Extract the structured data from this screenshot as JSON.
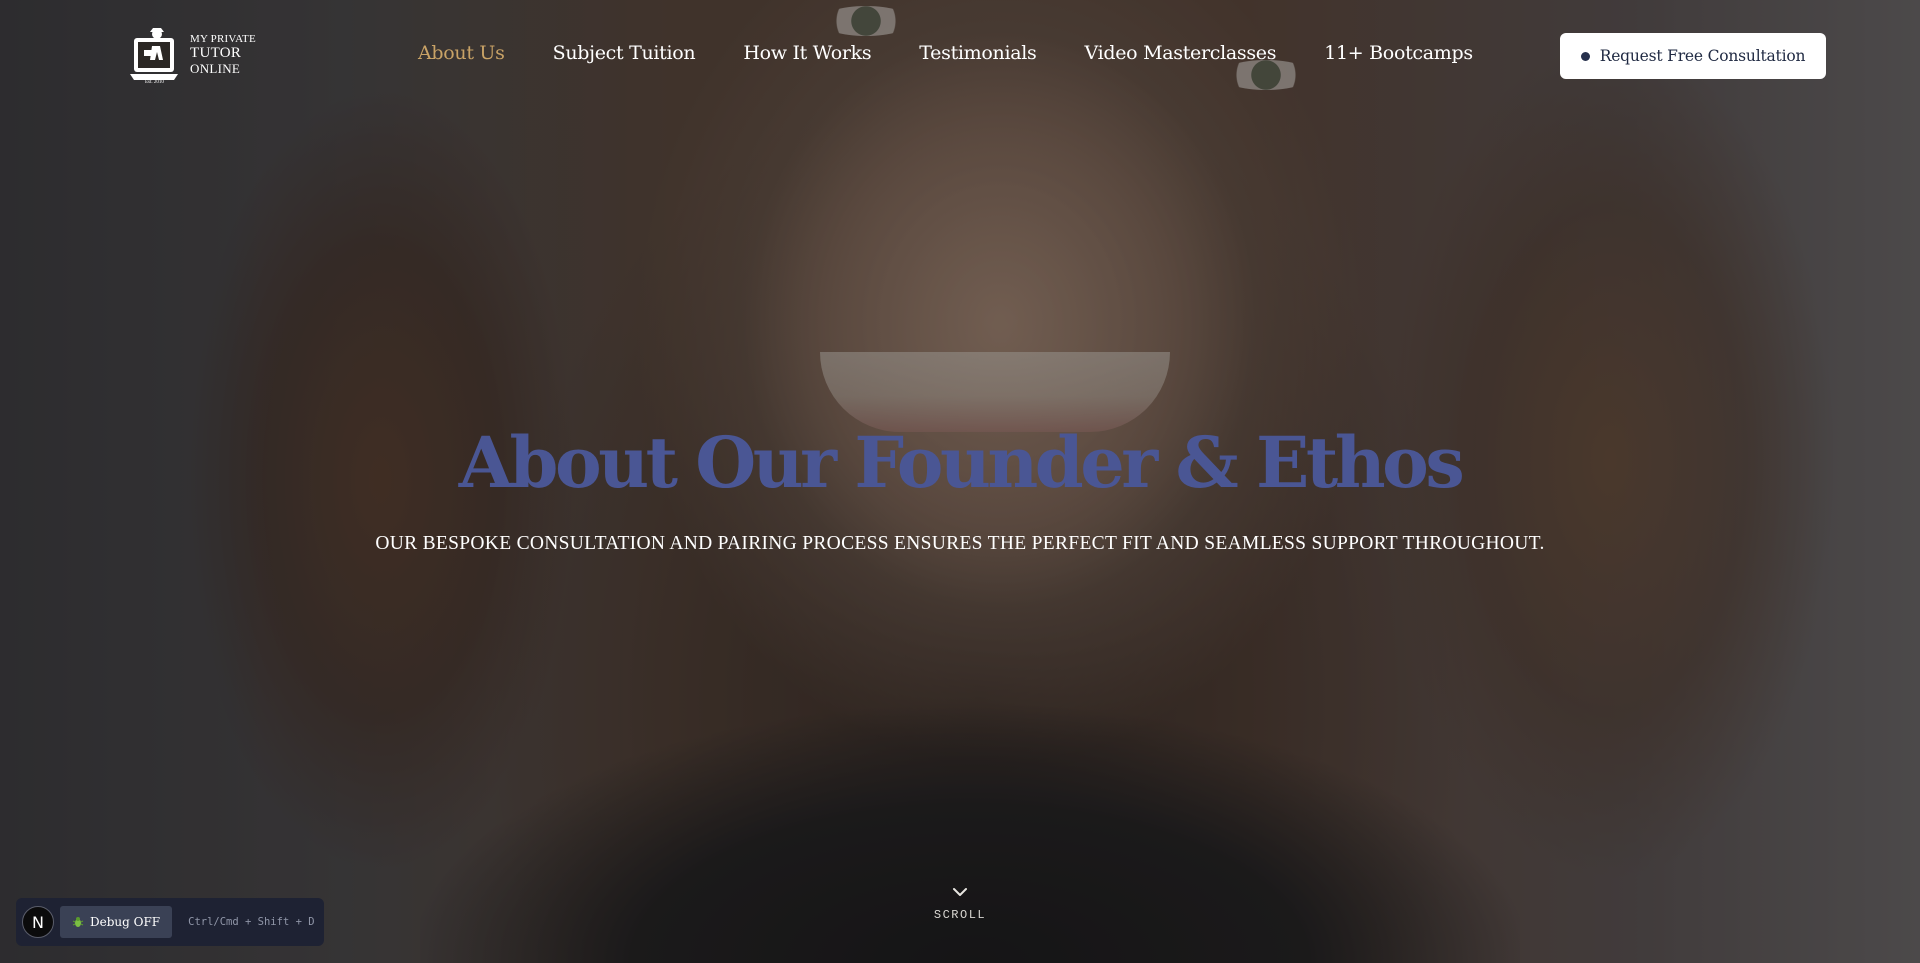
{
  "logo": {
    "line1": "MY PRIVATE",
    "line2": "TUTOR",
    "line3": "ONLINE",
    "est": "Est. 2010"
  },
  "nav": {
    "items": [
      {
        "label": "About Us",
        "active": true
      },
      {
        "label": "Subject Tuition",
        "active": false
      },
      {
        "label": "How It Works",
        "active": false
      },
      {
        "label": "Testimonials",
        "active": false
      },
      {
        "label": "Video Masterclasses",
        "active": false
      },
      {
        "label": "11+ Bootcamps",
        "active": false
      }
    ],
    "active_color": "#c9a366",
    "link_color": "#ffffff"
  },
  "cta": {
    "label": "Request Free Consultation",
    "background": "#ffffff",
    "text_color": "#1f2942"
  },
  "hero": {
    "title": "About Our Founder & Ethos",
    "title_color": "#4a5694",
    "subtitle": "OUR BESPOKE CONSULTATION AND PAIRING PROCESS ENSURES THE PERFECT FIT AND SEAMLESS SUPPORT THROUGHOUT.",
    "background_image": "smiling-girl-portrait"
  },
  "scroll": {
    "label": "SCROLL",
    "icon": "chevron-down-icon"
  },
  "debug": {
    "badge": "N",
    "toggle_label": "Debug OFF",
    "shortcut": "Ctrl/Cmd + Shift + D",
    "icon": "bug-icon"
  }
}
